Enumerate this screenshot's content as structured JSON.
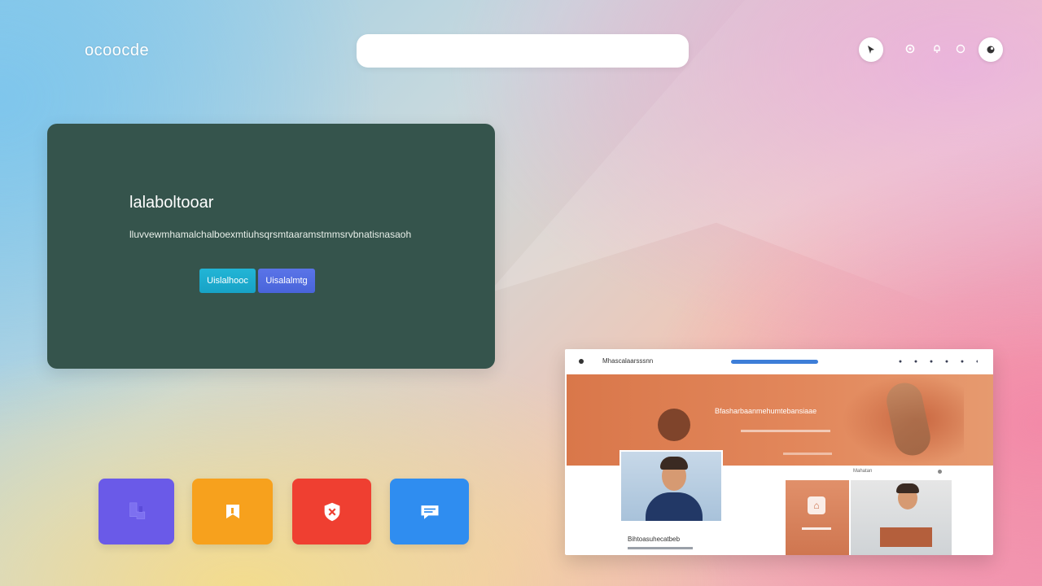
{
  "header": {
    "logo_text": "ocoocde",
    "search": {
      "value": "",
      "placeholder": ""
    },
    "icons": [
      "cursor-icon",
      "settings-icon",
      "bell-icon",
      "help-icon",
      "profile-icon"
    ]
  },
  "hero": {
    "title": "lalaboltooar",
    "subtitle": "lluvvewmhamalchalboexmtiuhsqrsmtaaramstmmsrvbnatisnasaoh",
    "primary_button": "Uislalhooc",
    "secondary_button": "Uisalalmtg"
  },
  "tiles": [
    {
      "icon": "puzzle-icon",
      "color": "#6a5ae8"
    },
    {
      "icon": "bookmark-icon",
      "color": "#f7a11d"
    },
    {
      "icon": "shield-icon",
      "color": "#ef3f31"
    },
    {
      "icon": "chat-icon",
      "color": "#2f8df0"
    }
  ],
  "preview": {
    "brand": "Mhascalaarsssnn",
    "hero_text": "Bfasharbaanmehumtebansiaae",
    "card_title": "Bihtoasuhecatbeb",
    "section_label": "Mahatan",
    "accent": "#3d7ed8",
    "hero_color": "#d9774a"
  }
}
